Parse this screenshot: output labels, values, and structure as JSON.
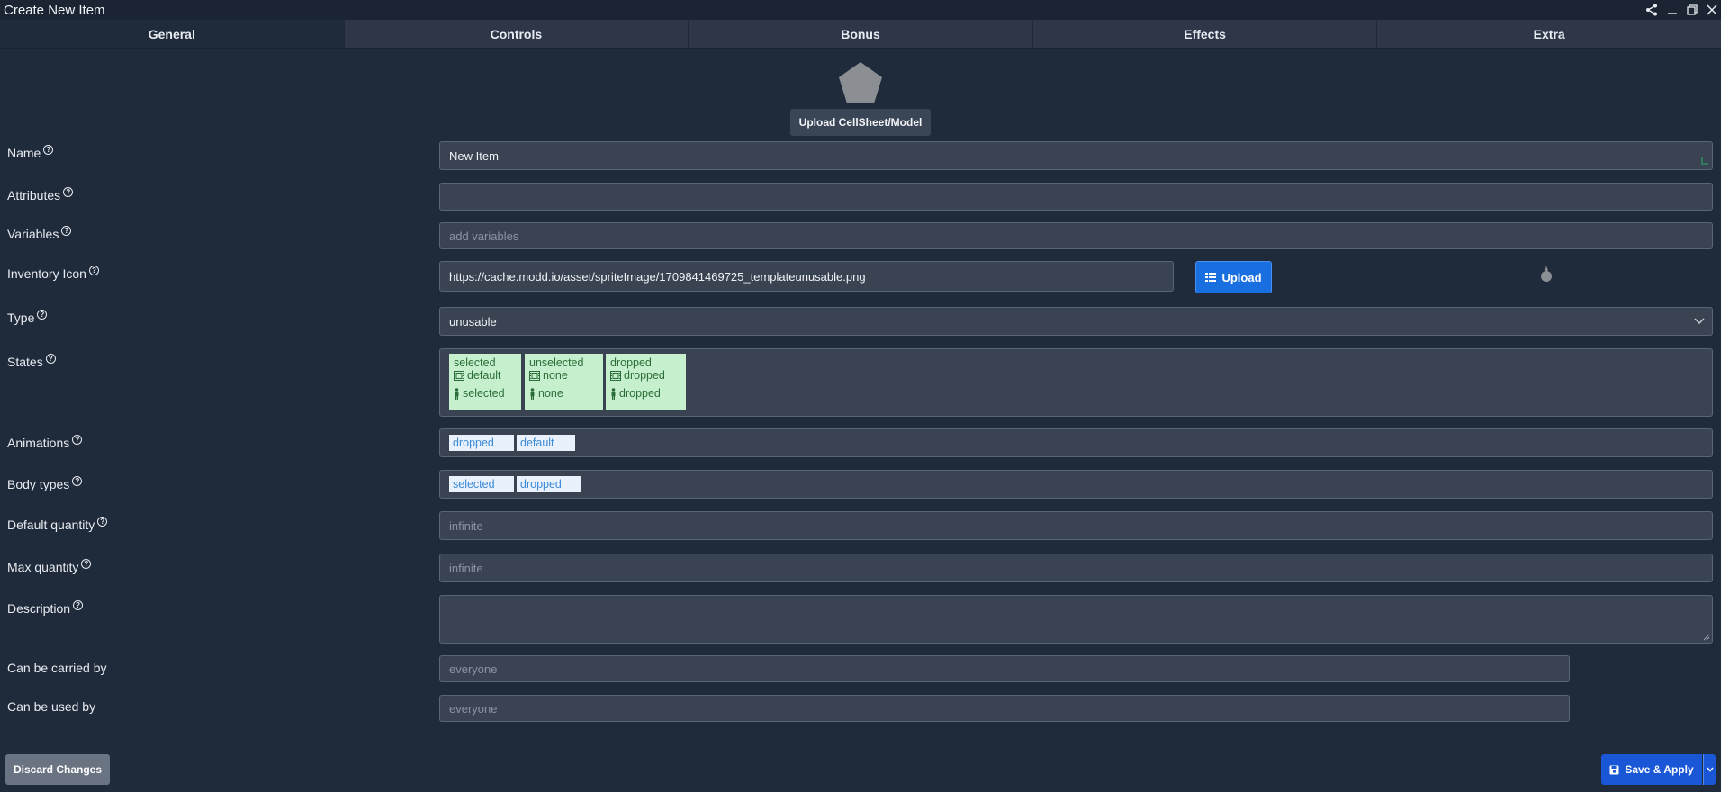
{
  "window": {
    "title": "Create New Item"
  },
  "tabs": [
    {
      "label": "General",
      "active": true
    },
    {
      "label": "Controls"
    },
    {
      "label": "Bonus"
    },
    {
      "label": "Effects"
    },
    {
      "label": "Extra"
    }
  ],
  "model": {
    "upload_label": "Upload CellSheet/Model"
  },
  "fields": {
    "name": {
      "label": "Name",
      "value": "New Item"
    },
    "attributes": {
      "label": "Attributes",
      "value": ""
    },
    "variables": {
      "label": "Variables",
      "placeholder": "add variables"
    },
    "inventory_icon": {
      "label": "Inventory Icon",
      "value": "https://cache.modd.io/asset/spriteImage/1709841469725_templateunusable.png",
      "upload_label": "Upload"
    },
    "type": {
      "label": "Type",
      "value": "unusable"
    },
    "states": {
      "label": "States",
      "items": [
        {
          "name": "selected",
          "animation": "default",
          "body": "selected"
        },
        {
          "name": "unselected",
          "animation": "none",
          "body": "none"
        },
        {
          "name": "dropped",
          "animation": "dropped",
          "body": "dropped"
        }
      ]
    },
    "animations": {
      "label": "Animations",
      "tags": [
        "dropped",
        "default"
      ]
    },
    "body_types": {
      "label": "Body types",
      "tags": [
        "selected",
        "dropped"
      ]
    },
    "default_quantity": {
      "label": "Default quantity",
      "placeholder": "infinite"
    },
    "max_quantity": {
      "label": "Max quantity",
      "placeholder": "infinite"
    },
    "description": {
      "label": "Description",
      "value": ""
    },
    "carried_by": {
      "label": "Can be carried by",
      "placeholder": "everyone"
    },
    "used_by": {
      "label": "Can be used by",
      "placeholder": "everyone"
    }
  },
  "footer": {
    "discard_label": "Discard Changes",
    "save_label": "Save & Apply"
  },
  "colors": {
    "background": "#1f2a3a",
    "field": "#3a4352",
    "accent": "#1a57d6",
    "state_card": "#c6f0cd",
    "tag": "#e8f1fc"
  },
  "icons": [
    "share-icon",
    "minimize-icon",
    "restore-icon",
    "close-icon",
    "pentagon-icon",
    "help-icon",
    "grid-icon",
    "bomb-icon",
    "film-icon",
    "body-icon",
    "save-icon",
    "chevron-down-icon"
  ]
}
